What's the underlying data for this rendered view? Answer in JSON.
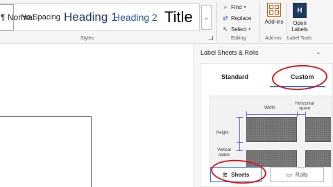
{
  "ribbon": {
    "styles": {
      "normal": "¶ Normal",
      "no_spacing": "No Spacing",
      "heading1": "Heading 1",
      "heading2": "Heading 2",
      "title": "Title",
      "group_label": "Styles"
    },
    "editing": {
      "find": "Find",
      "replace": "Replace",
      "select": "Select",
      "group_label": "Editing"
    },
    "addins": {
      "label": "Add-ins",
      "group_label": "Add-ins"
    },
    "label_tools": {
      "button_line1": "Open",
      "button_line2": "Labels",
      "group_label": "Label Tools"
    }
  },
  "pane": {
    "title": "Label Sheets & Rolls",
    "tabs": [
      {
        "label": "Standard",
        "active": false
      },
      {
        "label": "Custom",
        "active": true
      }
    ],
    "diagram": {
      "width_label": "Width",
      "horizontal_space_label": "Horizontal space",
      "height_label": "Height",
      "vertical_space_label": "Vertical space"
    },
    "buttons": {
      "sheets": "Sheets",
      "rolls": "Rolls"
    }
  },
  "colors": {
    "accent": "#2d7de0",
    "annotation": "#d51a1a",
    "heading": "#1f3864"
  }
}
